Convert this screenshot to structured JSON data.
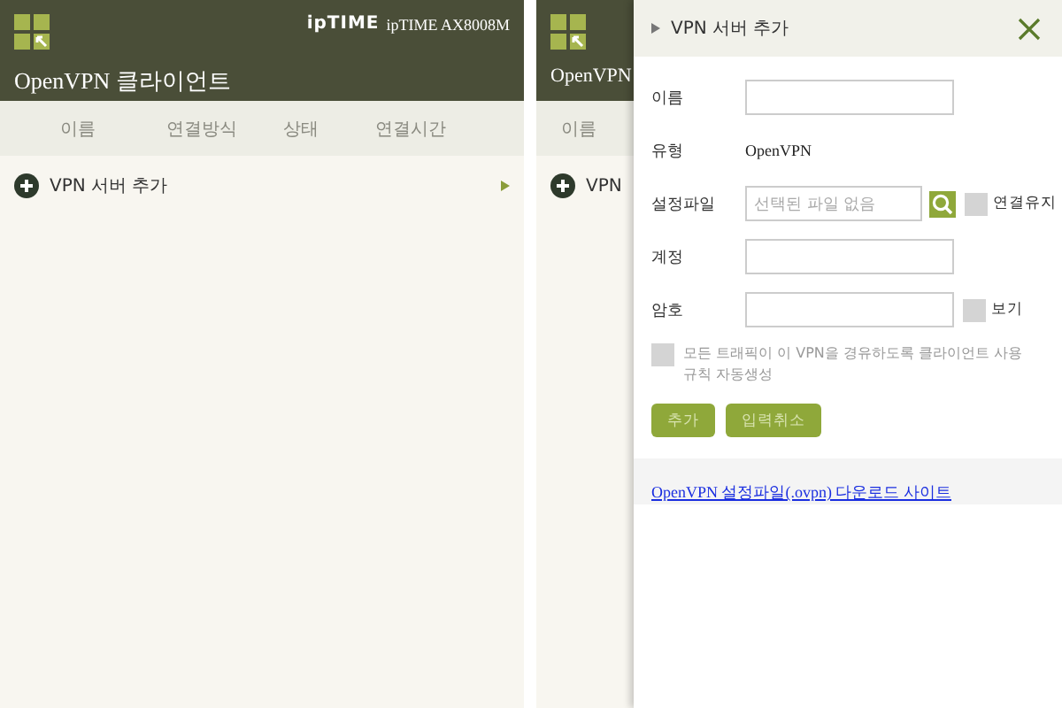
{
  "left_screen": {
    "logo": "ipTIME",
    "model": "ipTIME AX8008M",
    "title": "OpenVPN 클라이언트",
    "columns": [
      "이름",
      "연결방식",
      "상태",
      "연결시간"
    ],
    "add_label": "VPN 서버 추가"
  },
  "right_screen": {
    "background": {
      "title": "OpenVPN",
      "column": "이름",
      "add_label": "VPN"
    },
    "dialog": {
      "title": "VPN 서버 추가",
      "fields": [
        {
          "kind": "input",
          "label": "이름"
        },
        {
          "kind": "text",
          "label": "유형",
          "value": "OpenVPN"
        },
        {
          "kind": "file",
          "label": "설정파일",
          "placeholder": "선택된 파일 없음",
          "option": {
            "label": "연결유지",
            "checked": false
          }
        },
        {
          "kind": "input",
          "label": "계정"
        },
        {
          "kind": "password",
          "label": "암호",
          "option": {
            "label": "보기",
            "checked": false
          }
        }
      ],
      "auto_rule": {
        "label": "모든 트래픽이 이 VPN을 경유하도록 클라이언트 사용 규칙 자동생성",
        "checked": false
      },
      "buttons": [
        "추가",
        "입력취소"
      ],
      "link": "OpenVPN 설정파일(.ovpn) 다운로드 사이트"
    }
  }
}
